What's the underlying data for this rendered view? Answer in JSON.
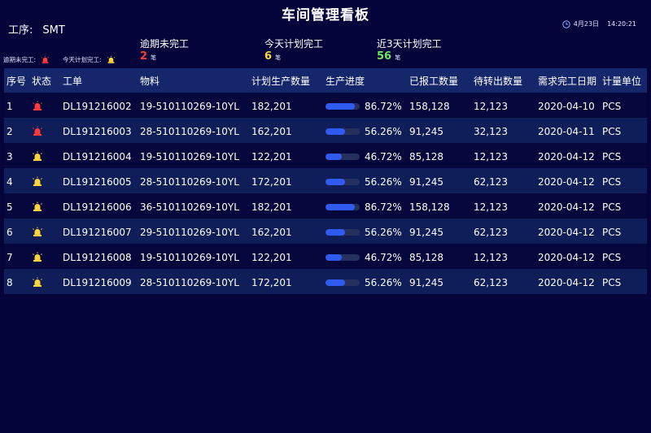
{
  "title": "车间管理看板",
  "process": {
    "label": "工序:",
    "value": "SMT"
  },
  "clock": {
    "date": "4月23日",
    "time": "14:20:21"
  },
  "stats": [
    {
      "label": "逾期未完工",
      "value": "2",
      "unit": "笔"
    },
    {
      "label": "今天计划完工",
      "value": "6",
      "unit": "笔"
    },
    {
      "label": "近3天计划完工",
      "value": "56",
      "unit": "笔"
    }
  ],
  "legend": {
    "overdue": "逾期未完工:",
    "today": "今天计划完工:"
  },
  "colors": {
    "background": "#04043a",
    "header": "#15276a",
    "row_alt": "#0f1d58",
    "overdue": "#ff3a3a",
    "today": "#ffd43a",
    "three_days": "#6ee85e",
    "progress": "#2f5bf0"
  },
  "columns": [
    "序号",
    "状态",
    "工单",
    "物料",
    "计划生产数量",
    "生产进度",
    "已报工数量",
    "待转出数量",
    "需求完工日期",
    "计量单位"
  ],
  "rows": [
    {
      "no": "1",
      "status": "red-alarm-icon",
      "order": "DL191216002",
      "material": "19-510110269-10YL",
      "plan": "182,201",
      "progress": 0.8672,
      "progress_text": "86.72%",
      "reported": "158,128",
      "pending": "12,123",
      "due": "2020-04-10",
      "unit": "PCS"
    },
    {
      "no": "2",
      "status": "red-alarm-icon",
      "order": "DL191216003",
      "material": "28-510110269-10YL",
      "plan": "162,201",
      "progress": 0.5626,
      "progress_text": "56.26%",
      "reported": "91,245",
      "pending": "32,123",
      "due": "2020-04-11",
      "unit": "PCS"
    },
    {
      "no": "3",
      "status": "yellow-alarm-icon",
      "order": "DL191216004",
      "material": "19-510110269-10YL",
      "plan": "122,201",
      "progress": 0.4672,
      "progress_text": "46.72%",
      "reported": "85,128",
      "pending": "12,123",
      "due": "2020-04-12",
      "unit": "PCS"
    },
    {
      "no": "4",
      "status": "yellow-alarm-icon",
      "order": "DL191216005",
      "material": "28-510110269-10YL",
      "plan": "172,201",
      "progress": 0.5626,
      "progress_text": "56.26%",
      "reported": "91,245",
      "pending": "62,123",
      "due": "2020-04-12",
      "unit": "PCS"
    },
    {
      "no": "5",
      "status": "yellow-alarm-icon",
      "order": "DL191216006",
      "material": "36-510110269-10YL",
      "plan": "182,201",
      "progress": 0.8672,
      "progress_text": "86.72%",
      "reported": "158,128",
      "pending": "12,123",
      "due": "2020-04-12",
      "unit": "PCS"
    },
    {
      "no": "6",
      "status": "yellow-alarm-icon",
      "order": "DL191216007",
      "material": "29-510110269-10YL",
      "plan": "162,201",
      "progress": 0.5626,
      "progress_text": "56.26%",
      "reported": "91,245",
      "pending": "62,123",
      "due": "2020-04-12",
      "unit": "PCS"
    },
    {
      "no": "7",
      "status": "yellow-alarm-icon",
      "order": "DL191216008",
      "material": "19-510110269-10YL",
      "plan": "122,201",
      "progress": 0.4672,
      "progress_text": "46.72%",
      "reported": "85,128",
      "pending": "12,123",
      "due": "2020-04-12",
      "unit": "PCS"
    },
    {
      "no": "8",
      "status": "yellow-alarm-icon",
      "order": "DL191216009",
      "material": "28-510110269-10YL",
      "plan": "172,201",
      "progress": 0.5626,
      "progress_text": "56.26%",
      "reported": "91,245",
      "pending": "62,123",
      "due": "2020-04-12",
      "unit": "PCS"
    }
  ]
}
